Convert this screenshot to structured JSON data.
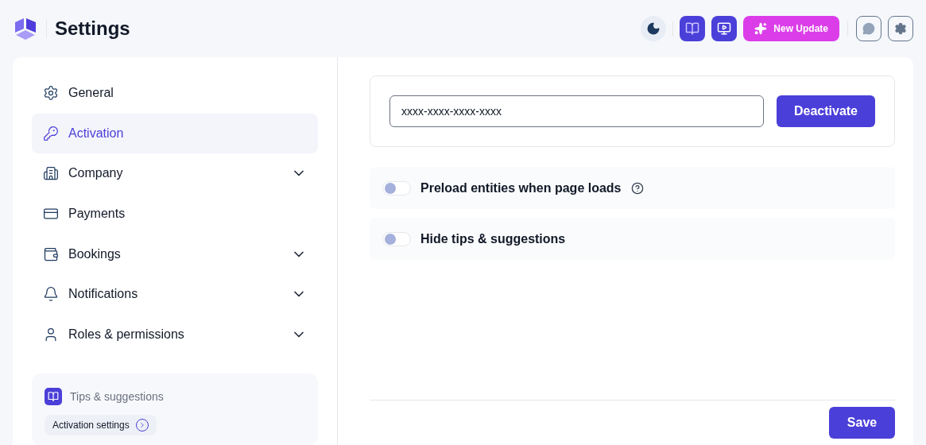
{
  "header": {
    "title": "Settings",
    "update_button": "New Update"
  },
  "sidebar": {
    "items": [
      {
        "label": "General",
        "selected": false,
        "expandable": false
      },
      {
        "label": "Activation",
        "selected": true,
        "expandable": false
      },
      {
        "label": "Company",
        "selected": false,
        "expandable": true
      },
      {
        "label": "Payments",
        "selected": false,
        "expandable": false
      },
      {
        "label": "Bookings",
        "selected": false,
        "expandable": true
      },
      {
        "label": "Notifications",
        "selected": false,
        "expandable": true
      },
      {
        "label": "Roles & permissions",
        "selected": false,
        "expandable": true
      }
    ],
    "tips": {
      "title": "Tips & suggestions",
      "link": "Activation settings"
    }
  },
  "license": {
    "value": "xxxx-xxxx-xxxx-xxxx",
    "button": "Deactivate"
  },
  "options": [
    {
      "label": "Preload entities when page loads",
      "on": false,
      "help": true
    },
    {
      "label": "Hide tips & suggestions",
      "on": false,
      "help": false
    }
  ],
  "footer": {
    "save": "Save"
  }
}
